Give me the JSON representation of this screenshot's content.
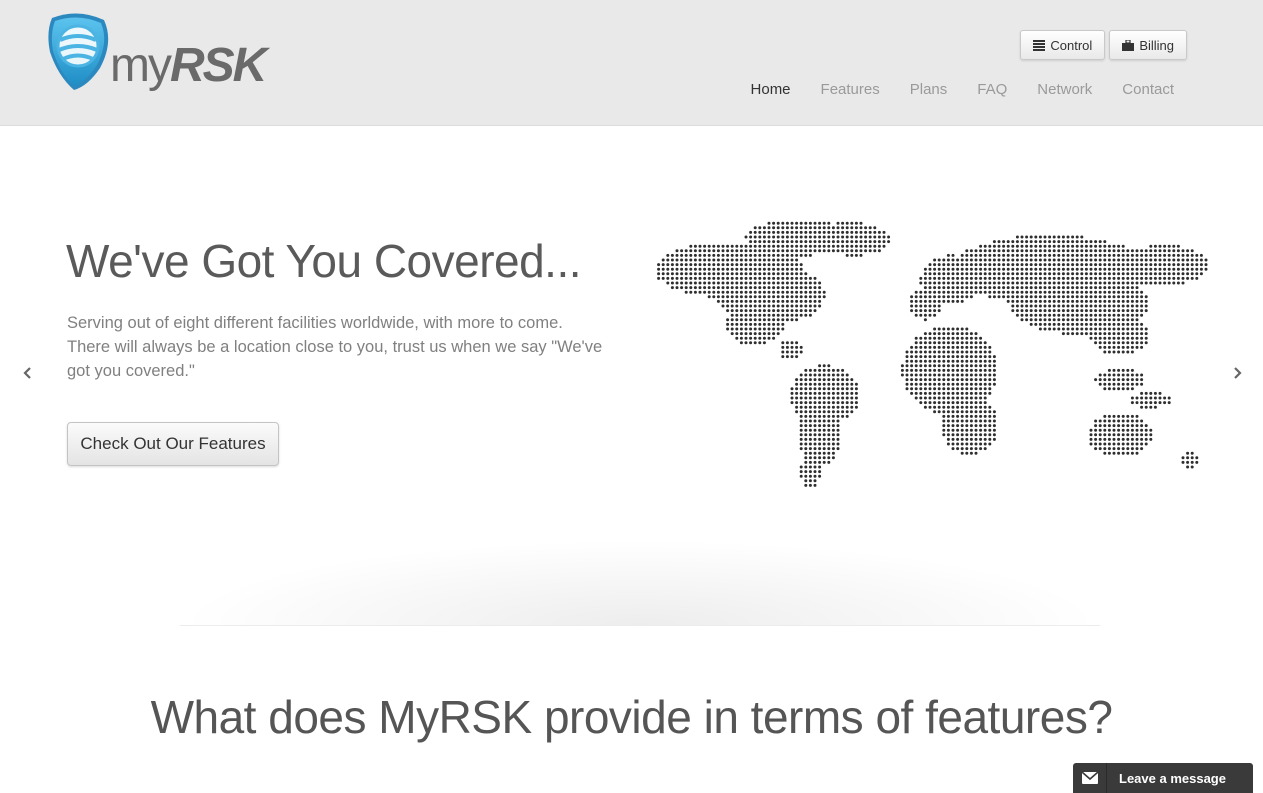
{
  "header": {
    "logo_text_my": "my",
    "logo_text_rsk": "RSK",
    "buttons": [
      {
        "label": "Control",
        "icon": "list-icon"
      },
      {
        "label": "Billing",
        "icon": "briefcase-icon"
      }
    ],
    "nav": [
      {
        "label": "Home",
        "active": true
      },
      {
        "label": "Features",
        "active": false
      },
      {
        "label": "Plans",
        "active": false
      },
      {
        "label": "FAQ",
        "active": false
      },
      {
        "label": "Network",
        "active": false
      },
      {
        "label": "Contact",
        "active": false
      }
    ]
  },
  "hero": {
    "title": "We've Got You Covered...",
    "text": "Serving out of eight different facilities worldwide, with more to come. There will always be a location close to you, trust us when we say \"We've got you covered.\"",
    "cta_label": "Check Out Our Features",
    "prev_icon": "chevron-left-icon",
    "next_icon": "chevron-right-icon",
    "map_icon": "world-map-icon"
  },
  "features": {
    "title": "What does MyRSK provide in terms of features?"
  },
  "chat": {
    "label": "Leave a message",
    "icon": "envelope-icon"
  },
  "colors": {
    "header_bg": "#e9e9e9",
    "logo_blue": "#3fa9d9",
    "chat_bg": "#3a3a3a"
  }
}
